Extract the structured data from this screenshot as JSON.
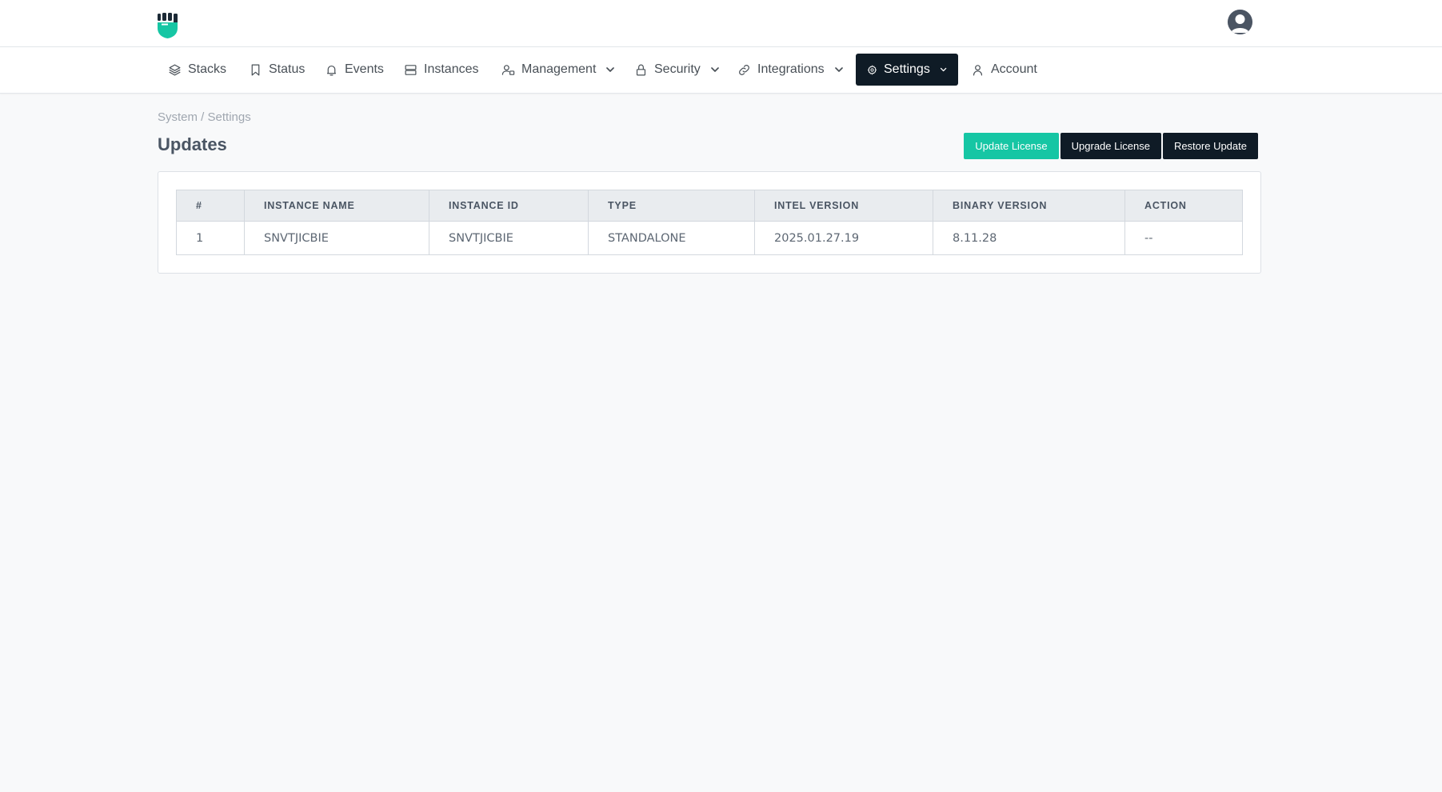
{
  "nav": {
    "items": [
      {
        "label": "Stacks",
        "icon": "layers-icon"
      },
      {
        "label": "Status",
        "icon": "bookmark-icon"
      },
      {
        "label": "Events",
        "icon": "bell-icon"
      },
      {
        "label": "Instances",
        "icon": "server-icon"
      },
      {
        "label": "Management",
        "icon": "user-settings-icon",
        "dropdown": true
      },
      {
        "label": "Security",
        "icon": "lock-icon",
        "dropdown": true
      },
      {
        "label": "Integrations",
        "icon": "link-icon",
        "dropdown": true
      },
      {
        "label": "Settings",
        "icon": "gear-icon",
        "dropdown": true,
        "active": true
      },
      {
        "label": "Account",
        "icon": "user-icon"
      }
    ]
  },
  "breadcrumb": "System / Settings",
  "page_title": "Updates",
  "buttons": {
    "update_license": "Update License",
    "upgrade_license": "Upgrade License",
    "restore_update": "Restore Update"
  },
  "table": {
    "headers": [
      "#",
      "INSTANCE NAME",
      "INSTANCE ID",
      "TYPE",
      "INTEL VERSION",
      "BINARY VERSION",
      "ACTION"
    ],
    "rows": [
      [
        "1",
        "SNVTJICBIE",
        "SNVTJICBIE",
        "STANDALONE",
        "2025.01.27.19",
        "8.11.28",
        "--"
      ]
    ]
  },
  "colors": {
    "accent": "#16c6a4",
    "dark": "#0f1b26",
    "background": "#f8f9fa"
  }
}
